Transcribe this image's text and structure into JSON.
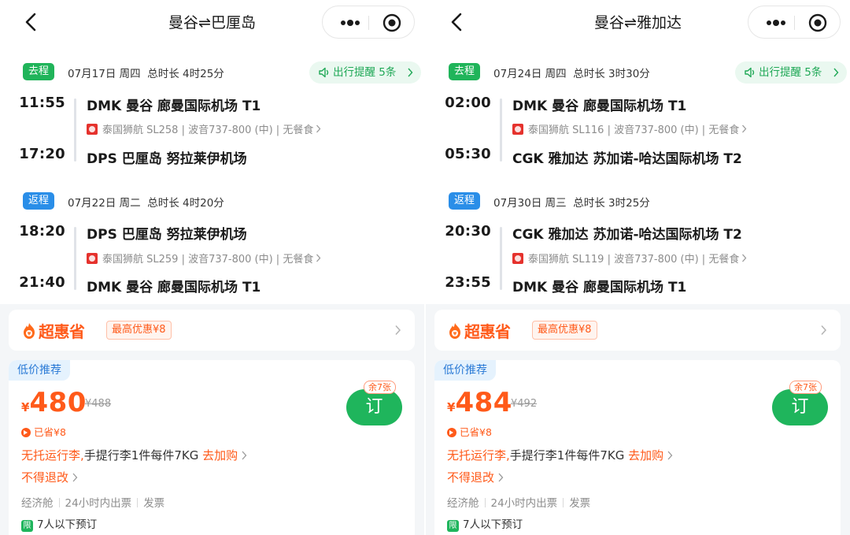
{
  "colors": {
    "accent_green": "#1fb55c",
    "return_blue": "#2a8ee8",
    "promo_orange": "#ff5a1a",
    "low_price_blue": "#2a7ad6"
  },
  "panels": [
    {
      "title": "曼谷⇌巴厘岛",
      "reminder": "出行提醒 5条",
      "outbound": {
        "badge": "去程",
        "date": "07月17日 周四",
        "duration": "总时长 4时25分",
        "dep_time": "11:55",
        "dep_airport": "DMK 曼谷 廊曼国际机场 T1",
        "info": "泰国狮航 SL258 | 波音737-800 (中) | 无餐食",
        "arr_time": "17:20",
        "arr_airport": "DPS 巴厘岛 努拉莱伊机场"
      },
      "return": {
        "badge": "返程",
        "date": "07月22日 周二",
        "duration": "总时长 4时20分",
        "dep_time": "18:20",
        "dep_airport": "DPS 巴厘岛 努拉莱伊机场",
        "info": "泰国狮航 SL259 | 波音737-800 (中) | 无餐食",
        "arr_time": "21:40",
        "arr_airport": "DMK 曼谷 廊曼国际机场 T1"
      },
      "promo": {
        "brand": "超惠省",
        "tag": "最高优惠¥8"
      },
      "offer": {
        "label": "低价推荐",
        "currency": "¥",
        "price": "480",
        "original": "¥488",
        "saved": "已省¥8",
        "book": "订",
        "tickets_left": "余7张",
        "baggage_highlight": "无托运行李,",
        "baggage_text": "手提行李1件每件7KG",
        "baggage_link": "去加购",
        "refund": "不得退改",
        "cabin": "经济舱",
        "ticketing": "24小时内出票",
        "invoice": "发票",
        "limit_badge": "限",
        "limit": "7人以下预订"
      }
    },
    {
      "title": "曼谷⇌雅加达",
      "reminder": "出行提醒 5条",
      "outbound": {
        "badge": "去程",
        "date": "07月24日 周四",
        "duration": "总时长 3时30分",
        "dep_time": "02:00",
        "dep_airport": "DMK 曼谷 廊曼国际机场 T1",
        "info": "泰国狮航 SL116 | 波音737-800 (中) | 无餐食",
        "arr_time": "05:30",
        "arr_airport": "CGK 雅加达 苏加诺-哈达国际机场 T2"
      },
      "return": {
        "badge": "返程",
        "date": "07月30日 周三",
        "duration": "总时长 3时25分",
        "dep_time": "20:30",
        "dep_airport": "CGK 雅加达 苏加诺-哈达国际机场 T2",
        "info": "泰国狮航 SL119 | 波音737-800 (中) | 无餐食",
        "arr_time": "23:55",
        "arr_airport": "DMK 曼谷 廊曼国际机场 T1"
      },
      "promo": {
        "brand": "超惠省",
        "tag": "最高优惠¥8"
      },
      "offer": {
        "label": "低价推荐",
        "currency": "¥",
        "price": "484",
        "original": "¥492",
        "saved": "已省¥8",
        "book": "订",
        "tickets_left": "余7张",
        "baggage_highlight": "无托运行李,",
        "baggage_text": "手提行李1件每件7KG",
        "baggage_link": "去加购",
        "refund": "不得退改",
        "cabin": "经济舱",
        "ticketing": "24小时内出票",
        "invoice": "发票",
        "limit_badge": "限",
        "limit": "7人以下预订"
      }
    }
  ]
}
